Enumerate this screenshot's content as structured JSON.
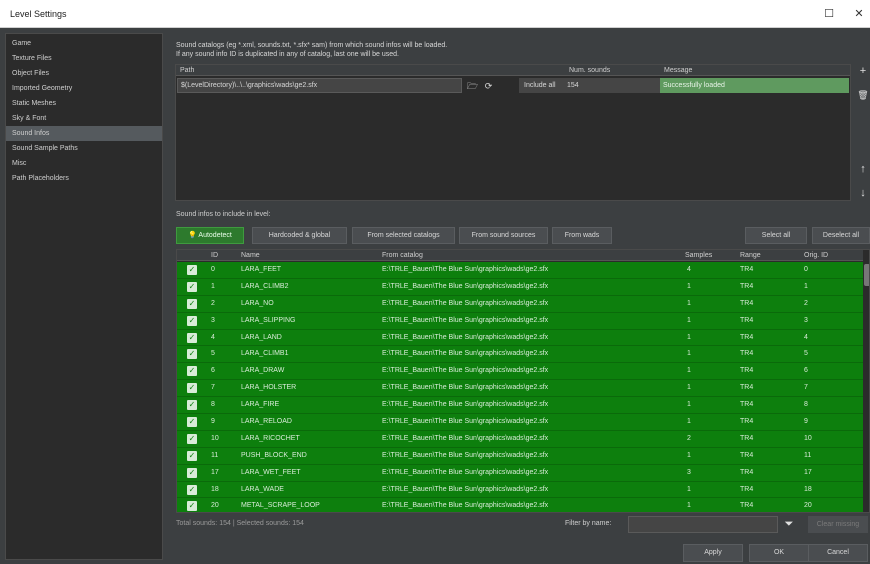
{
  "window": {
    "title": "Level Settings",
    "maximize_glyph": "☐",
    "close_glyph": "✕"
  },
  "sidebar": {
    "items": [
      "Game",
      "Texture Files",
      "Object Files",
      "Imported Geometry",
      "Static Meshes",
      "Sky & Font",
      "Sound Infos",
      "Sound Sample Paths",
      "Misc",
      "Path Placeholders"
    ],
    "active_index": 6
  },
  "catalogs": {
    "info_line1": "Sound catalogs (eg *.xml, sounds.txt, *.sfx* sam) from which sound infos will be loaded.",
    "info_line2": "If any sound info ID is duplicated in any of catalog, last one will be used.",
    "headers": {
      "path": "Path",
      "num_sounds": "Num. sounds",
      "message": "Message"
    },
    "row": {
      "path": "$(LevelDirectory)\\..\\..\\graphics\\wads\\ge2.sfx",
      "include_label": "Include all",
      "num_sounds": "154",
      "message": "Successfully loaded"
    },
    "side_buttons": {
      "add": "+",
      "delete": "🗑",
      "up": "↑",
      "down": "↓"
    }
  },
  "sounds": {
    "section_label": "Sound infos to include in level:",
    "filters": {
      "autodetect": "Autodetect",
      "hardcoded": "Hardcoded & global",
      "from_catalogs": "From selected catalogs",
      "from_sources": "From sound sources",
      "from_wads": "From wads",
      "select_all": "Select all",
      "deselect_all": "Deselect all"
    },
    "headers": {
      "id": "ID",
      "name": "Name",
      "from_catalog": "From catalog",
      "samples": "Samples",
      "range": "Range",
      "orig_id": "Orig. ID"
    },
    "rows": [
      {
        "id": "0",
        "name": "LARA_FEET",
        "catalog": "E:\\TRLE_Bauen\\The Blue Sun\\graphics\\wads\\ge2.sfx",
        "samples": "4",
        "range": "TR4",
        "orig_id": "0"
      },
      {
        "id": "1",
        "name": "LARA_CLIMB2",
        "catalog": "E:\\TRLE_Bauen\\The Blue Sun\\graphics\\wads\\ge2.sfx",
        "samples": "1",
        "range": "TR4",
        "orig_id": "1"
      },
      {
        "id": "2",
        "name": "LARA_NO",
        "catalog": "E:\\TRLE_Bauen\\The Blue Sun\\graphics\\wads\\ge2.sfx",
        "samples": "1",
        "range": "TR4",
        "orig_id": "2"
      },
      {
        "id": "3",
        "name": "LARA_SLIPPING",
        "catalog": "E:\\TRLE_Bauen\\The Blue Sun\\graphics\\wads\\ge2.sfx",
        "samples": "1",
        "range": "TR4",
        "orig_id": "3"
      },
      {
        "id": "4",
        "name": "LARA_LAND",
        "catalog": "E:\\TRLE_Bauen\\The Blue Sun\\graphics\\wads\\ge2.sfx",
        "samples": "1",
        "range": "TR4",
        "orig_id": "4"
      },
      {
        "id": "5",
        "name": "LARA_CLIMB1",
        "catalog": "E:\\TRLE_Bauen\\The Blue Sun\\graphics\\wads\\ge2.sfx",
        "samples": "1",
        "range": "TR4",
        "orig_id": "5"
      },
      {
        "id": "6",
        "name": "LARA_DRAW",
        "catalog": "E:\\TRLE_Bauen\\The Blue Sun\\graphics\\wads\\ge2.sfx",
        "samples": "1",
        "range": "TR4",
        "orig_id": "6"
      },
      {
        "id": "7",
        "name": "LARA_HOLSTER",
        "catalog": "E:\\TRLE_Bauen\\The Blue Sun\\graphics\\wads\\ge2.sfx",
        "samples": "1",
        "range": "TR4",
        "orig_id": "7"
      },
      {
        "id": "8",
        "name": "LARA_FIRE",
        "catalog": "E:\\TRLE_Bauen\\The Blue Sun\\graphics\\wads\\ge2.sfx",
        "samples": "1",
        "range": "TR4",
        "orig_id": "8"
      },
      {
        "id": "9",
        "name": "LARA_RELOAD",
        "catalog": "E:\\TRLE_Bauen\\The Blue Sun\\graphics\\wads\\ge2.sfx",
        "samples": "1",
        "range": "TR4",
        "orig_id": "9"
      },
      {
        "id": "10",
        "name": "LARA_RICOCHET",
        "catalog": "E:\\TRLE_Bauen\\The Blue Sun\\graphics\\wads\\ge2.sfx",
        "samples": "2",
        "range": "TR4",
        "orig_id": "10"
      },
      {
        "id": "11",
        "name": "PUSH_BLOCK_END",
        "catalog": "E:\\TRLE_Bauen\\The Blue Sun\\graphics\\wads\\ge2.sfx",
        "samples": "1",
        "range": "TR4",
        "orig_id": "11"
      },
      {
        "id": "17",
        "name": "LARA_WET_FEET",
        "catalog": "E:\\TRLE_Bauen\\The Blue Sun\\graphics\\wads\\ge2.sfx",
        "samples": "3",
        "range": "TR4",
        "orig_id": "17"
      },
      {
        "id": "18",
        "name": "LARA_WADE",
        "catalog": "E:\\TRLE_Bauen\\The Blue Sun\\graphics\\wads\\ge2.sfx",
        "samples": "1",
        "range": "TR4",
        "orig_id": "18"
      },
      {
        "id": "20",
        "name": "METAL_SCRAPE_LOOP",
        "catalog": "E:\\TRLE_Bauen\\The Blue Sun\\graphics\\wads\\ge2.sfx",
        "samples": "1",
        "range": "TR4",
        "orig_id": "20"
      }
    ],
    "status": "Total sounds: 154 | Selected sounds: 154",
    "filter_label": "Filter by name:",
    "filter_value": "",
    "clear_missing": "Clear missing"
  },
  "footer": {
    "apply": "Apply",
    "ok": "OK",
    "cancel": "Cancel"
  },
  "colors": {
    "row_green": "#0d7f0d",
    "autodetect_green": "#2d7a2d",
    "loaded_green": "#5f9a5f",
    "panel_bg": "#2b2b2b",
    "dialog_bg": "#3c3f41"
  },
  "icons": {
    "folder": "folder-icon",
    "reload": "reload-icon",
    "filter": "filter-icon",
    "autodetect": "lightbulb-icon",
    "check": "checkbox-checked-icon"
  }
}
